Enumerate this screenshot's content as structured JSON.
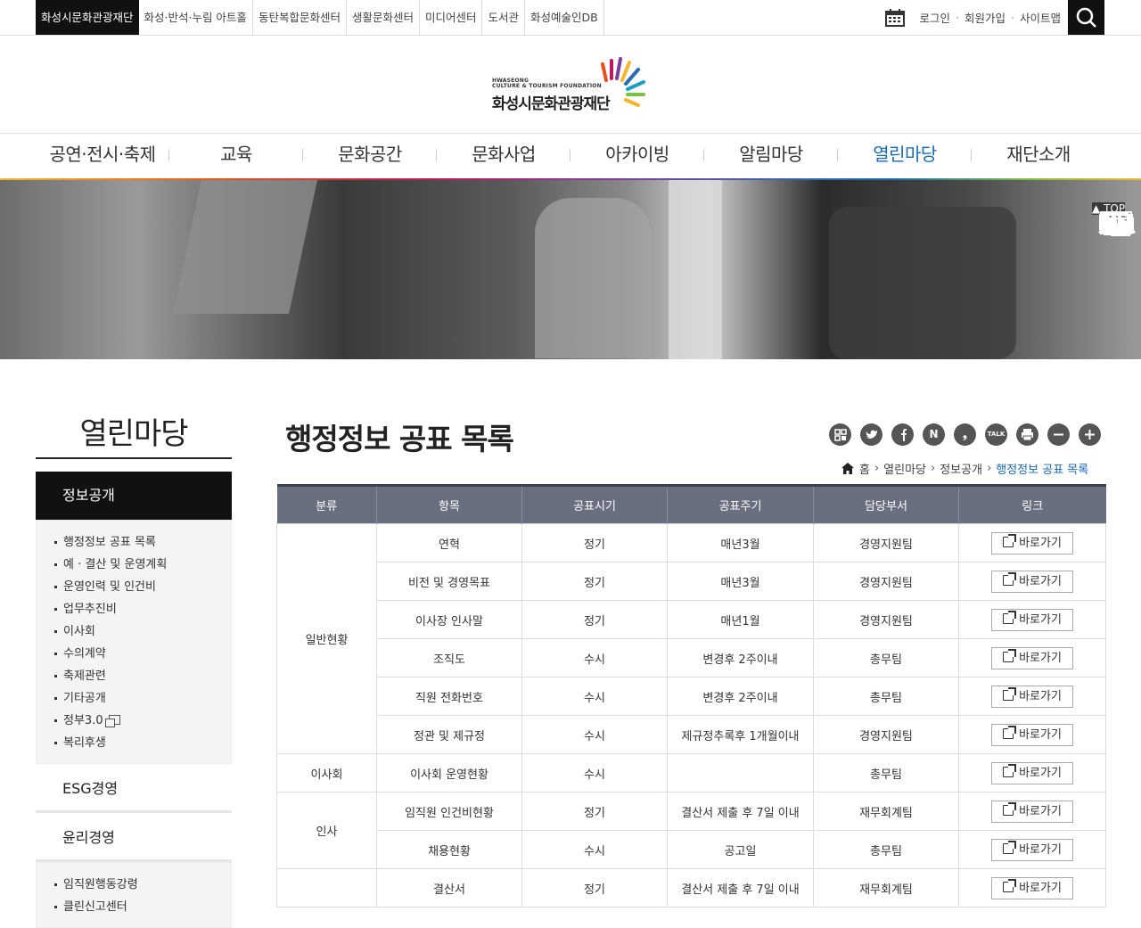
{
  "topbar": {
    "sites": [
      "화성시문화관광재단",
      "화성·반석·누림 아트홀",
      "동탄복합문화센터",
      "생활문화센터",
      "미디어센터",
      "도서관",
      "화성예술인DB"
    ],
    "login": "로그인",
    "join": "회원가입",
    "sitemap": "사이트맵",
    "sep": "·"
  },
  "logo": {
    "en_line1": "HWASEONG",
    "en_line2": "CULTURE & TOURISM FOUNDATION",
    "ko": "화성시문화관광재단"
  },
  "gnb": [
    "공연·전시·축제",
    "교육",
    "문화공간",
    "문화사업",
    "아카이빙",
    "알림마당",
    "열린마당",
    "재단소개"
  ],
  "quick": {
    "top": "TOP"
  },
  "sidebar": {
    "title": "열린마당",
    "section1": "정보공개",
    "items1": [
      "행정정보 공표 목록",
      "예 · 결산 및 운영계획",
      "운영인력 및 인건비",
      "업무추진비",
      "이사회",
      "수의계약",
      "축제관련",
      "기타공개",
      "정부3.0",
      "복리후생"
    ],
    "section2": "ESG경영",
    "section3": "윤리경영",
    "items3": [
      "임직원행동강령",
      "클린신고센터"
    ]
  },
  "content": {
    "title": "행정정보 공표 목록",
    "sns": [
      "N",
      "❟",
      "TALK"
    ],
    "breadcrumb": {
      "home": "홈",
      "b1": "열린마당",
      "b2": "정보공개",
      "current": "행정정보 공표 목록"
    }
  },
  "table": {
    "headers": [
      "분류",
      "항목",
      "공표시기",
      "공표주기",
      "담당부서",
      "링크"
    ],
    "link_label": "바로가기",
    "groups": [
      {
        "category": "일반현황",
        "rows": [
          [
            "연혁",
            "정기",
            "매년3월",
            "경영지원팀"
          ],
          [
            "비전 및 경영목표",
            "정기",
            "매년3월",
            "경영지원팀"
          ],
          [
            "이사장 인사말",
            "정기",
            "매년1월",
            "경영지원팀"
          ],
          [
            "조직도",
            "수시",
            "변경후 2주이내",
            "총무팀"
          ],
          [
            "직원 전화번호",
            "수시",
            "변경후 2주이내",
            "총무팀"
          ],
          [
            "정관 및 제규정",
            "수시",
            "제규정추록후 1개월이내",
            "경영지원팀"
          ]
        ]
      },
      {
        "category": "이사회",
        "rows": [
          [
            "이사회 운영현황",
            "수시",
            "",
            "총무팀"
          ]
        ]
      },
      {
        "category": "인사",
        "rows": [
          [
            "임직원 인건비현황",
            "정기",
            "결산서 제출 후 7일 이내",
            "재무회계팀"
          ],
          [
            "채용현황",
            "수시",
            "공고일",
            "총무팀"
          ]
        ]
      },
      {
        "category": "",
        "rows": [
          [
            "결산서",
            "정기",
            "결산서 제출 후 7일 이내",
            "재무회계팀"
          ]
        ]
      }
    ]
  }
}
